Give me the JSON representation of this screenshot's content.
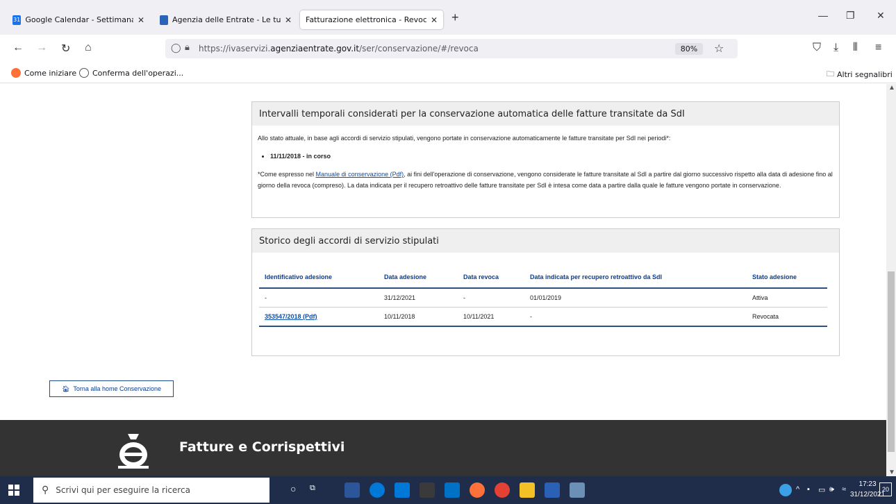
{
  "tabs": [
    {
      "title": "Google Calendar - Settimana de",
      "favicon_text": "31"
    },
    {
      "title": "Agenzia delle Entrate - Le tue fat",
      "favicon_text": ""
    },
    {
      "title": "Fatturazione elettronica - Revoca",
      "favicon_text": ""
    }
  ],
  "url": {
    "prefix": "https://ivaservizi.",
    "domain": "agenziaentrate.gov.it",
    "path": "/ser/conservazione/#/revoca"
  },
  "zoom": "80%",
  "bookmarks": {
    "item1": "Come iniziare",
    "item2": "Conferma dell'operazi...",
    "other": "Altri segnalibri"
  },
  "panel1": {
    "title": "Intervalli temporali considerati per la conservazione automatica delle fatture transitate da SdI",
    "intro": "Allo stato attuale, in base agli accordi di servizio stipulati, vengono portate in conservazione automaticamente le fatture transitate per SdI nei periodi*:",
    "period": "11/11/2018 - in corso",
    "note_pre": "*Come espresso nel ",
    "note_link": "Manuale di conservazione (Pdf)",
    "note_post": ", ai fini dell'operazione di conservazione, vengono considerate le fatture transitate al SdI a partire dal giorno successivo rispetto alla data di adesione fino al giorno della revoca (compreso). La data indicata per il recupero retroattivo delle fatture transitate per SdI è intesa come data a partire dalla quale le fatture vengono portate in conservazione."
  },
  "panel2": {
    "title": "Storico degli accordi di servizio stipulati",
    "headers": [
      "Identificativo adesione",
      "Data adesione",
      "Data revoca",
      "Data indicata per recupero retroattivo da SdI",
      "Stato adesione"
    ],
    "rows": [
      [
        "-",
        "31/12/2021",
        "-",
        "01/01/2019",
        "Attiva"
      ],
      [
        "353547/2018 (Pdf)",
        "10/11/2018",
        "10/11/2021",
        "-",
        "Revocata"
      ]
    ]
  },
  "home_button": "Torna alla home Conservazione",
  "footer_brand": "Fatture e Corrispettivi",
  "taskbar": {
    "search_placeholder": "Scrivi qui per eseguire la ricerca",
    "time": "17:23",
    "date": "31/12/2021",
    "notifications": "20"
  }
}
